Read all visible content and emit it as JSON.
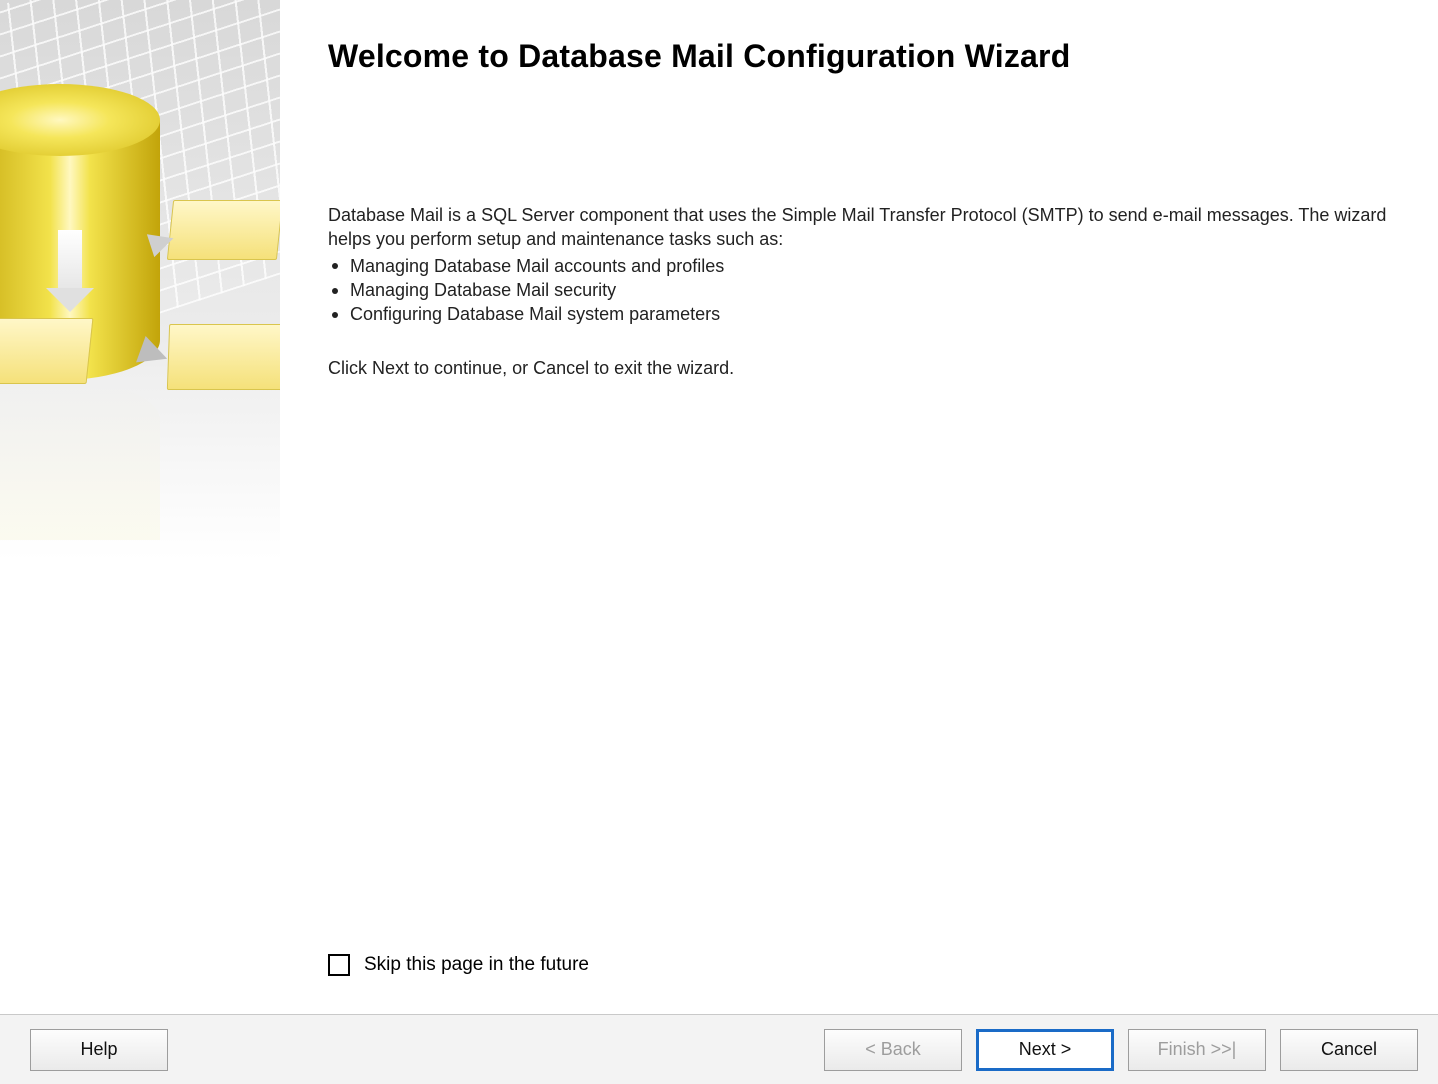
{
  "header": {
    "title": "Welcome to Database Mail Configuration Wizard"
  },
  "body": {
    "intro": "Database Mail is a SQL Server component that uses the Simple Mail Transfer Protocol (SMTP) to send e-mail messages. The wizard helps you perform setup and maintenance tasks such as:",
    "bullets": [
      "Managing Database Mail accounts and profiles",
      "Managing Database Mail security",
      "Configuring Database Mail system parameters"
    ],
    "next_hint": "Click Next to continue, or Cancel to exit the wizard.",
    "skip_label": "Skip this page in the future",
    "skip_checked": false
  },
  "footer": {
    "help": "Help",
    "back": "< Back",
    "next": "Next >",
    "finish": "Finish >>|",
    "cancel": "Cancel",
    "back_enabled": false,
    "next_enabled": true,
    "finish_enabled": false,
    "cancel_enabled": true
  }
}
